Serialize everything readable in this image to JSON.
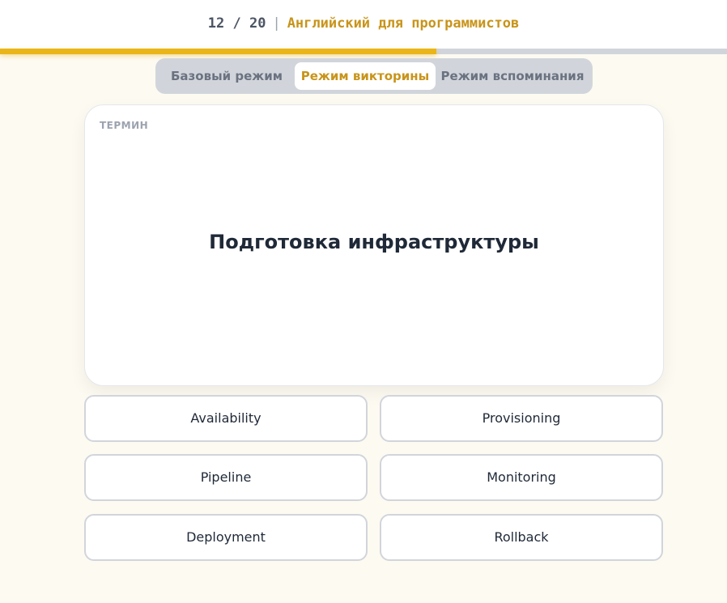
{
  "header": {
    "current": "12",
    "separator": "/",
    "total": "20",
    "divider": "|",
    "deck_title": "Английский для программистов",
    "progress_fraction": 0.6
  },
  "mode_switch": {
    "tabs": [
      {
        "label": "Базовый режим",
        "active": false
      },
      {
        "label": "Режим викторины",
        "active": true
      },
      {
        "label": "Режим вспоминания",
        "active": false
      }
    ]
  },
  "card": {
    "label": "ТЕРМИН",
    "term": "Подготовка инфраструктуры"
  },
  "answers": [
    {
      "label": "Availability"
    },
    {
      "label": "Provisioning"
    },
    {
      "label": "Pipeline"
    },
    {
      "label": "Monitoring"
    },
    {
      "label": "Deployment"
    },
    {
      "label": "Rollback"
    }
  ],
  "colors": {
    "accent": "#eab518",
    "accent_text": "#c8941a",
    "background": "#fdfaf1"
  }
}
